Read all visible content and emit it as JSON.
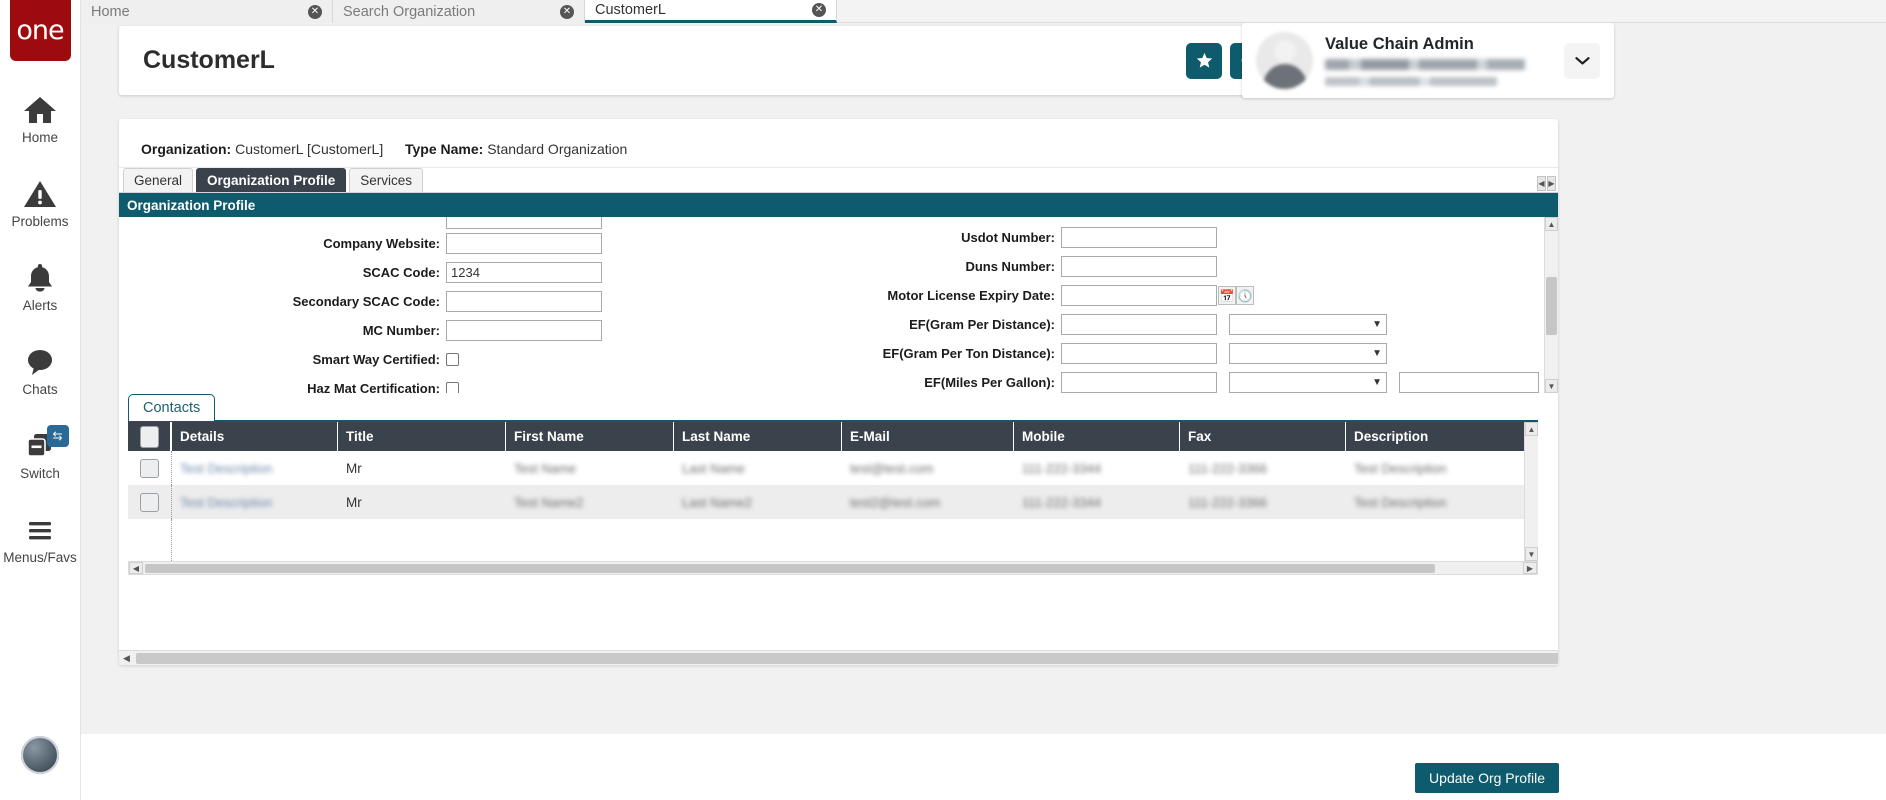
{
  "brand": {
    "logo_text": "one"
  },
  "sidebar": {
    "items": [
      {
        "label": "Home",
        "icon": "home-icon"
      },
      {
        "label": "Problems",
        "icon": "warning-triangle-icon"
      },
      {
        "label": "Alerts",
        "icon": "bell-icon"
      },
      {
        "label": "Chats",
        "icon": "chat-bubble-icon"
      },
      {
        "label": "Switch",
        "icon": "windows-stack-icon",
        "badge_icon": "swap-arrows-icon"
      },
      {
        "label": "Menus/Favs",
        "icon": "hamburger-icon"
      }
    ]
  },
  "browser_tabs": [
    {
      "label": "Home",
      "active": false,
      "close": "✕"
    },
    {
      "label": "Search Organization",
      "active": false,
      "close": "✕"
    },
    {
      "label": "CustomerL",
      "active": true,
      "close": "✕"
    }
  ],
  "header": {
    "title": "CustomerL",
    "actions": [
      {
        "name": "favorite-button",
        "glyph": "★"
      },
      {
        "name": "refresh-button",
        "glyph": "⟳"
      },
      {
        "name": "close-button",
        "glyph": "✕"
      }
    ],
    "menu_badge_glyph": "★"
  },
  "user": {
    "name": "Value Chain Admin",
    "caret": "⌄"
  },
  "record": {
    "organization_label": "Organization:",
    "organization_value": "CustomerL [CustomerL]",
    "type_name_label": "Type Name:",
    "type_name_value": "Standard Organization"
  },
  "sub_tabs": [
    {
      "label": "General",
      "active": false
    },
    {
      "label": "Organization Profile",
      "active": true
    },
    {
      "label": "Services",
      "active": false
    }
  ],
  "section": {
    "title": "Organization Profile"
  },
  "form": {
    "left": [
      {
        "label": "Company Website:",
        "value": "",
        "type": "text"
      },
      {
        "label": "SCAC Code:",
        "value": "1234",
        "type": "text"
      },
      {
        "label": "Secondary SCAC Code:",
        "value": "",
        "type": "text"
      },
      {
        "label": "MC Number:",
        "value": "",
        "type": "text"
      },
      {
        "label": "Smart Way Certified:",
        "value": "",
        "type": "checkbox",
        "checked": false
      },
      {
        "label": "Haz Mat Certification:",
        "value": "",
        "type": "checkbox",
        "checked": false
      }
    ],
    "right": [
      {
        "label": "Usdot Number:",
        "value": "",
        "type": "text"
      },
      {
        "label": "Duns Number:",
        "value": "",
        "type": "text"
      },
      {
        "label": "Motor License Expiry Date:",
        "value": "",
        "type": "datetime",
        "calendar_icon": "calendar-icon",
        "clock_icon": "clock-icon"
      },
      {
        "label": "EF(Gram Per Distance):",
        "value": "",
        "type": "text_select",
        "select_value": ""
      },
      {
        "label": "EF(Gram Per Ton Distance):",
        "value": "",
        "type": "text_select",
        "select_value": ""
      },
      {
        "label": "EF(Miles Per Gallon):",
        "value": "",
        "type": "text_select_extra",
        "select_value": "",
        "extra_value": ""
      }
    ]
  },
  "contacts": {
    "tab_label": "Contacts",
    "columns": [
      "Details",
      "Title",
      "First Name",
      "Last Name",
      "E-Mail",
      "Mobile",
      "Fax",
      "Description"
    ],
    "rows": [
      {
        "details": "Test Description",
        "title": "Mr",
        "first_name": "Test Name",
        "last_name": "Last Name",
        "email": "test@test.com",
        "mobile": "111-222-3344",
        "fax": "111-222-3366",
        "description": "Test Description"
      },
      {
        "details": "Test Description",
        "title": "Mr",
        "first_name": "Test Name2",
        "last_name": "Last Name2",
        "email": "test2@test.com",
        "mobile": "111-222-3344",
        "fax": "111-222-3366",
        "description": "Test Description"
      }
    ]
  },
  "footer": {
    "update_label": "Update Org Profile"
  },
  "colors": {
    "brand_red": "#9e0b0f",
    "teal": "#0d5b6d",
    "dark_slate": "#3a424c",
    "badge_red": "#b3181f",
    "switch_blue": "#2b6a96"
  }
}
